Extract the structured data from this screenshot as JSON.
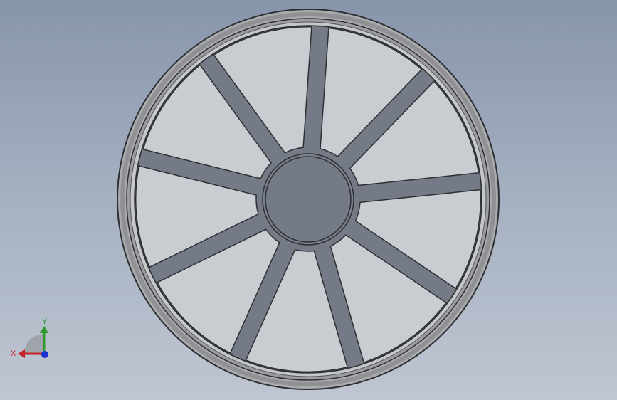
{
  "viewport": {
    "background_top": "#8795ab",
    "background_bottom": "#bfc6d2"
  },
  "model": {
    "type": "spoked-wheel",
    "spoke_count": 9,
    "face_color": "#747a86",
    "edge_color": "#2d2f33",
    "rim_color": "#a7a9ab",
    "rim_shadow_color": "#8a8c8f"
  },
  "triad": {
    "x_label": "X",
    "y_label": "Y",
    "x_color": "#c8202a",
    "y_color": "#2e9a2e",
    "z_color": "#1c2fd0"
  }
}
